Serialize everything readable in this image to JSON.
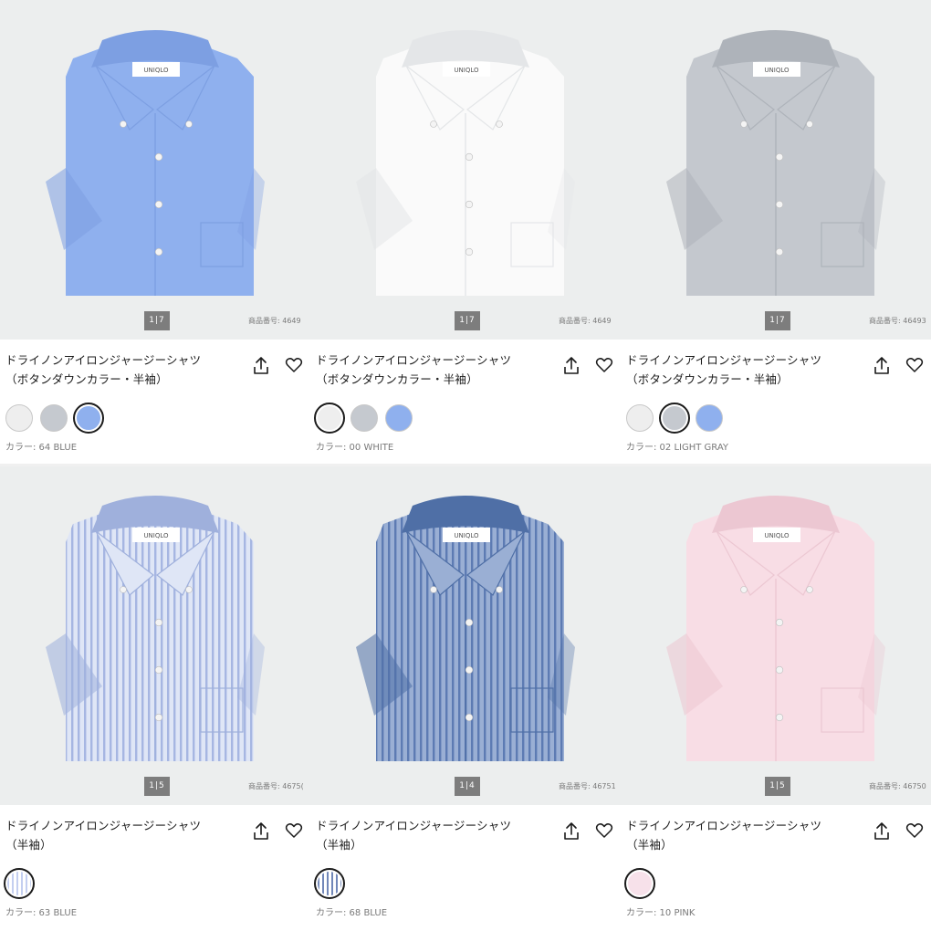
{
  "products": [
    {
      "name_line1": "ドライノンアイロンジャージーシャツ",
      "name_line2": "（ボタンダウンカラー・半袖）",
      "image_counter": "1|7",
      "product_code": "商品番号: 4649",
      "shirt_color": "#8fb0ee",
      "shirt_shade": "#7d9fe2",
      "striped": false,
      "swatches": [
        {
          "color": "#eeeeee",
          "selected": false
        },
        {
          "color": "#c5c9cf",
          "selected": false
        },
        {
          "color": "#8fb0ee",
          "selected": true
        }
      ],
      "color_label": "カラー: 64 BLUE"
    },
    {
      "name_line1": "ドライノンアイロンジャージーシャツ",
      "name_line2": "（ボタンダウンカラー・半袖）",
      "image_counter": "1|7",
      "product_code": "商品番号: 4649",
      "shirt_color": "#fafafa",
      "shirt_shade": "#e4e6e8",
      "striped": false,
      "swatches": [
        {
          "color": "#eeeeee",
          "selected": true
        },
        {
          "color": "#c5c9cf",
          "selected": false
        },
        {
          "color": "#8fb0ee",
          "selected": false
        }
      ],
      "color_label": "カラー: 00 WHITE"
    },
    {
      "name_line1": "ドライノンアイロンジャージーシャツ",
      "name_line2": "（ボタンダウンカラー・半袖）",
      "image_counter": "1|7",
      "product_code": "商品番号: 46493",
      "shirt_color": "#c4c8ce",
      "shirt_shade": "#aeb3ba",
      "striped": false,
      "swatches": [
        {
          "color": "#eeeeee",
          "selected": false
        },
        {
          "color": "#c5c9cf",
          "selected": true
        },
        {
          "color": "#8fb0ee",
          "selected": false
        }
      ],
      "color_label": "カラー: 02 LIGHT GRAY"
    },
    {
      "name_line1": "ドライノンアイロンジャージーシャツ",
      "name_line2": "（半袖）",
      "image_counter": "1|5",
      "product_code": "商品番号: 4675(",
      "shirt_color": "#dfe6f6",
      "shirt_shade": "#9fb0dc",
      "striped": true,
      "stripe_color": "#a6b6e2",
      "swatches": [
        {
          "color": "#c4cff0",
          "selected": true
        }
      ],
      "color_label": "カラー: 63 BLUE"
    },
    {
      "name_line1": "ドライノンアイロンジャージーシャツ",
      "name_line2": "（半袖）",
      "image_counter": "1|4",
      "product_code": "商品番号: 46751",
      "shirt_color": "#9aafd4",
      "shirt_shade": "#4f6fa6",
      "striped": true,
      "stripe_color": "#5d7bb3",
      "swatches": [
        {
          "color": "#7187b8",
          "selected": true
        }
      ],
      "color_label": "カラー: 68 BLUE"
    },
    {
      "name_line1": "ドライノンアイロンジャージーシャツ",
      "name_line2": "（半袖）",
      "image_counter": "1|5",
      "product_code": "商品番号: 46750",
      "shirt_color": "#f8dde5",
      "shirt_shade": "#ecc7d2",
      "striped": false,
      "swatches": [
        {
          "color": "#f7e1ea",
          "selected": true
        }
      ],
      "color_label": "カラー: 10 PINK"
    }
  ],
  "icons": {
    "share": "share-icon",
    "favorite": "heart-icon"
  }
}
